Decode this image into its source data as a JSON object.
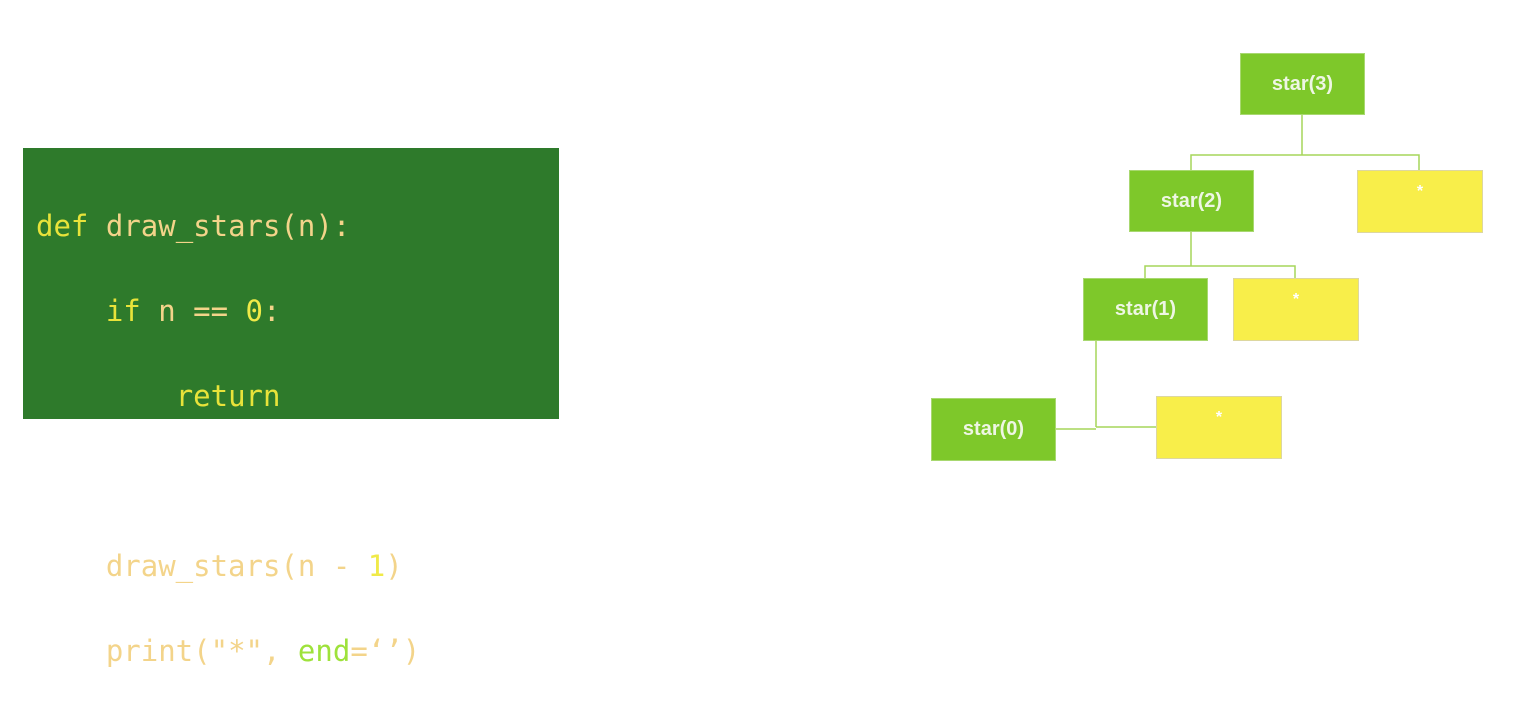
{
  "code": {
    "line1": {
      "kw": "def",
      "fn": "draw_stars",
      "rest": "(n):"
    },
    "line2": {
      "kw": "if",
      "rest": " n == ",
      "num": "0",
      "colon": ":"
    },
    "line3": {
      "kw": "return"
    },
    "line5": {
      "fn": "draw_stars",
      "rest": "(n - ",
      "num": "1",
      "close": ")"
    },
    "line6": {
      "fn": "print",
      "open": "(\"*\", ",
      "kw": "end",
      "rest": "=‘’)"
    }
  },
  "tree": {
    "call_nodes": [
      "star(3)",
      "star(2)",
      "star(1)",
      "star(0)"
    ],
    "output_nodes": [
      "*",
      "*",
      "*"
    ]
  },
  "colors": {
    "code_bg": "#2e7a2b",
    "call_node": "#7ec82a",
    "output_node": "#f8ee4a",
    "connector": "#a6d65a"
  }
}
